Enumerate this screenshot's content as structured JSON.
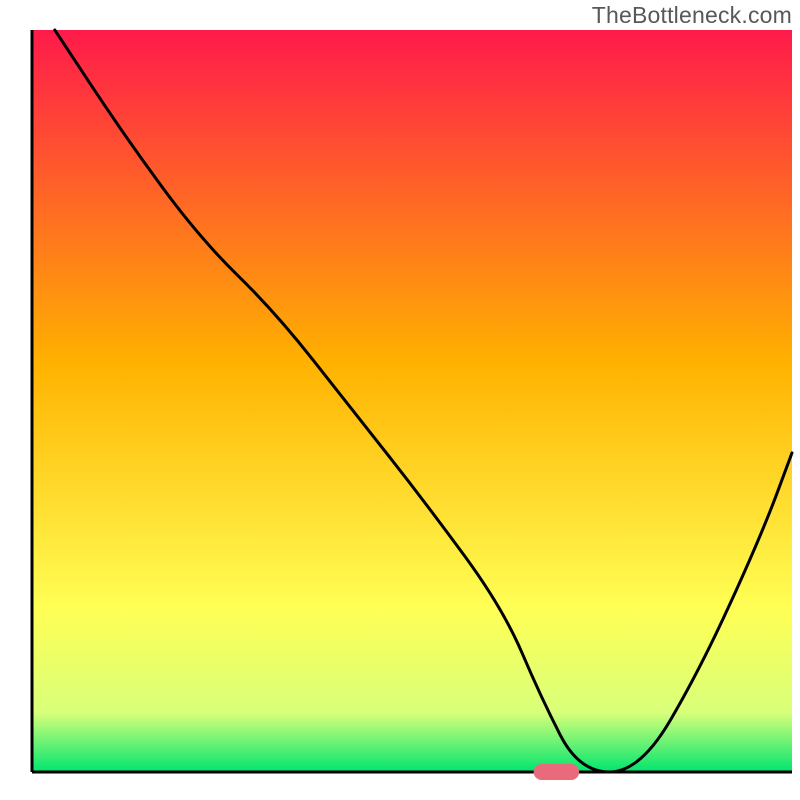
{
  "watermark": "TheBottleneck.com",
  "chart_data": {
    "type": "line",
    "title": "",
    "xlabel": "",
    "ylabel": "",
    "xlim": [
      0,
      100
    ],
    "ylim": [
      0,
      100
    ],
    "x": [
      3,
      12,
      22,
      32,
      42,
      52,
      62,
      67,
      72,
      80,
      88,
      96,
      100
    ],
    "values": [
      100,
      86,
      72,
      62,
      49,
      36,
      22,
      10,
      0,
      0,
      14,
      32,
      43
    ],
    "marker": {
      "x_range": [
        66,
        72
      ],
      "y": 0
    },
    "background_gradient": {
      "top_color": "#ff1a4b",
      "mid_color": "#ffb200",
      "low_color": "#ffff55",
      "bottom_color": "#00e56f"
    },
    "axis_color": "#000000",
    "curve_color": "#000000",
    "marker_color": "#e96a7a"
  }
}
